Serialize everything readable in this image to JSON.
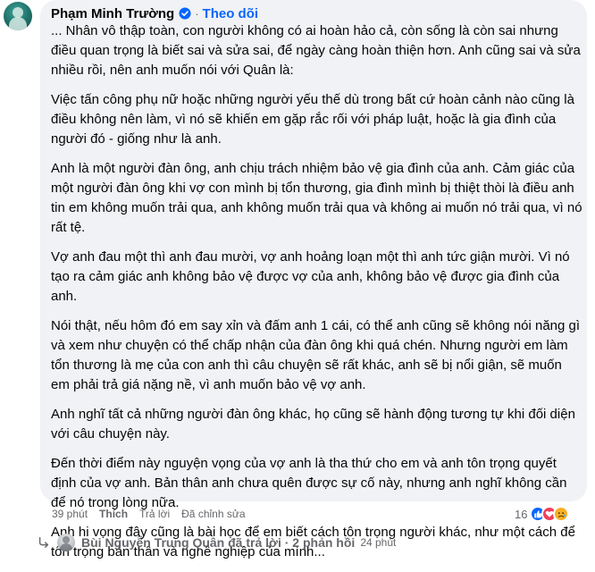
{
  "comment": {
    "author": "Phạm Minh Trường",
    "follow_label": "Theo dõi",
    "separator": "·",
    "paragraphs": [
      "... Nhân vô thập toàn, con người không có ai hoàn hảo cả, còn sống là còn sai nhưng điều quan trọng là biết sai và sửa sai, để ngày càng hoàn thiện hơn. Anh cũng sai và sửa nhiều rồi, nên anh muốn nói với Quân là:",
      "Việc tấn công phụ nữ hoặc những người yếu thế dù trong bất cứ hoàn cảnh nào cũng là điều không nên làm, vì nó sẽ khiến em gặp rắc rối với pháp luật, hoặc là gia đình của người đó - giống như là anh.",
      "Anh là một người đàn ông, anh chịu trách nhiệm bảo vệ gia đình của anh. Cảm giác của một người đàn ông khi vợ con mình bị tổn thương, gia đình mình bị thiệt thòi là điều anh tin em không muốn trải qua, anh không muốn trải qua và không ai muốn nó trải qua, vì nó rất tệ.",
      "Vợ anh đau một thì anh đau mười, vợ anh hoảng loạn một thì anh tức giận mười. Vì nó tạo ra cảm giác anh không bảo vệ được vợ của anh, không bảo vệ được gia đình của anh.",
      "Nói thật, nếu hôm đó em say xỉn và đấm anh 1 cái, có thể anh cũng sẽ không nói năng gì và xem như chuyện có thể chấp nhận của đàn ông khi quá chén. Nhưng người em làm tổn thương là mẹ của con anh thì câu chuyện sẽ rất khác, anh sẽ bị nổi giận, sẽ muốn em phải trả giá nặng nề, vì anh muốn bảo vệ vợ anh.",
      "Anh nghĩ tất cả những người đàn ông khác, họ cũng sẽ hành động tương tự khi đối diện với câu chuyện này.",
      "Đến thời điểm này nguyện vọng của vợ anh là tha thứ cho em và anh tôn trọng quyết định của vợ anh. Bản thân anh chưa quên được sự cố này, nhưng anh nghĩ không cần để nó trong lòng nữa.",
      "Anh hi vọng đây cũng là bài học để em biết cách tôn trọng người khác, như một cách để tôn trọng bản thân và nghề nghiệp của mình..."
    ]
  },
  "actions": {
    "time": "39 phút",
    "like": "Thích",
    "reply": "Trả lời",
    "edited": "Đã chỉnh sửa"
  },
  "reactions": {
    "count": "16",
    "icons": [
      "like-icon",
      "love-icon",
      "sad-icon"
    ]
  },
  "reply_summary": {
    "text": "Bùi Nguyễn Trung Quân đã trả lời · 2 phản hồi",
    "time": "24 phút"
  },
  "colors": {
    "accent": "#0866ff",
    "bubble": "#f0f2f5",
    "muted": "#65676b"
  }
}
